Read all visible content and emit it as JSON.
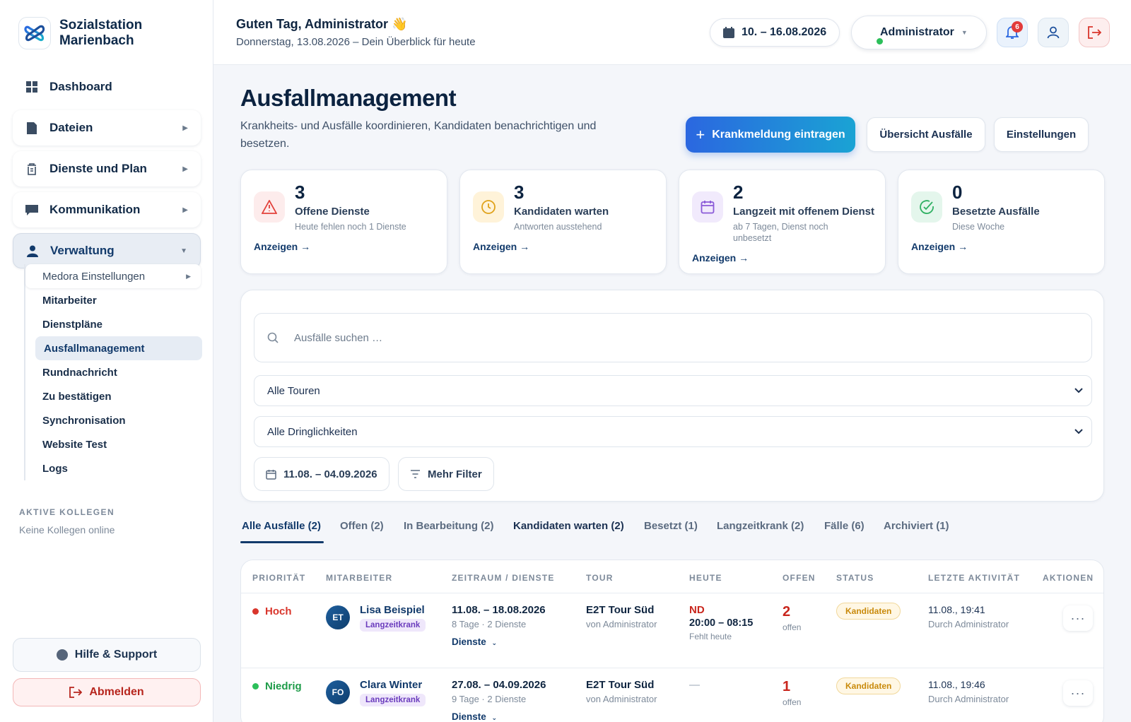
{
  "brand": {
    "name": "Sozialstation Marienbach"
  },
  "nav": {
    "items": [
      {
        "label": "Dashboard"
      },
      {
        "label": "Dateien"
      },
      {
        "label": "Dienste und Plan"
      },
      {
        "label": "Kommunikation"
      },
      {
        "label": "Verwaltung"
      }
    ],
    "sub": [
      {
        "label": "Medora Einstellungen"
      },
      {
        "label": "Mitarbeiter"
      },
      {
        "label": "Dienstpläne"
      },
      {
        "label": "Ausfallmanagement"
      },
      {
        "label": "Rundnachricht"
      },
      {
        "label": "Zu bestätigen"
      },
      {
        "label": "Synchronisation"
      },
      {
        "label": "Website Test"
      },
      {
        "label": "Logs"
      }
    ]
  },
  "colleagues": {
    "title": "AKTIVE KOLLEGEN",
    "text": "Keine Kollegen online"
  },
  "footer": {
    "help": "Hilfe & Support",
    "logout": "Abmelden"
  },
  "header": {
    "greeting": "Guten Tag, Administrator",
    "wave": "👋",
    "subtitle": "Donnerstag, 13.08.2026 – Dein Überblick für heute",
    "date_range": "10. – 16.08.2026",
    "user": "Administrator",
    "notifications": "6"
  },
  "page": {
    "title": "Ausfallmanagement",
    "description": "Krankheits- und Ausfälle koordinieren, Kandidaten benachrichtigen und besetzen.",
    "primary": "Krankmeldung eintragen",
    "overview": "Übersicht Ausfälle",
    "settings": "Einstellungen"
  },
  "stats": [
    {
      "value": "3",
      "label": "Offene Dienste",
      "sub": "Heute fehlen noch 1 Dienste",
      "link": "Anzeigen →",
      "color": "#e2403a"
    },
    {
      "value": "3",
      "label": "Kandidaten warten",
      "sub": "Antworten ausstehend",
      "link": "Anzeigen →",
      "color": "#e0a21a"
    },
    {
      "value": "2",
      "label": "Langzeit mit offenem Dienst",
      "sub": "ab 7 Tagen, Dienst noch unbesetzt",
      "link": "Anzeigen →",
      "color": "#8a5ad8"
    },
    {
      "value": "0",
      "label": "Besetzte Ausfälle",
      "sub": "Diese Woche",
      "link": "Anzeigen →",
      "color": "#2fb062"
    }
  ],
  "filters": {
    "search_placeholder": "Ausfälle suchen …",
    "tours": "Alle Touren",
    "urgency": "Alle Dringlichkeiten",
    "date": "11.08. – 04.09.2026",
    "more": "Mehr Filter"
  },
  "tabs": [
    "Alle Ausfälle (2)",
    "Offen (2)",
    "In Bearbeitung (2)",
    "Kandidaten warten (2)",
    "Besetzt (1)",
    "Langzeitkrank (2)",
    "Fälle (6)",
    "Archiviert (1)"
  ],
  "table": {
    "headers": [
      "PRIORITÄT",
      "MITARBEITER",
      "ZEITRAUM / DIENSTE",
      "TOUR",
      "HEUTE",
      "OFFEN",
      "STATUS",
      "LETZTE AKTIVITÄT",
      "AKTIONEN"
    ],
    "rows": [
      {
        "priority": "Hoch",
        "priority_color": "#d9362c",
        "initials": "ET",
        "name": "Lisa Beispiel",
        "tag": "Langzeitkrank",
        "period": "11.08. – 18.08.2026",
        "period_sub": "8 Tage · 2 Dienste",
        "dienste": "Dienste",
        "tour": "E2T Tour Süd",
        "tour_sub": "von Administrator",
        "today_code": "ND",
        "today_time": "20:00 – 08:15",
        "today_sub": "Fehlt heute",
        "open": "2",
        "open_sub": "offen",
        "status": "Kandidaten",
        "last": "11.08., 19:41",
        "last_sub": "Durch Administrator"
      },
      {
        "priority": "Niedrig",
        "priority_color": "#1f9c4a",
        "initials": "FO",
        "name": "Clara Winter",
        "tag": "Langzeitkrank",
        "period": "27.08. – 04.09.2026",
        "period_sub": "9 Tage · 2 Dienste",
        "dienste": "Dienste",
        "tour": "E2T Tour Süd",
        "tour_sub": "von Administrator",
        "today_dash": "—",
        "open": "1",
        "open_sub": "offen",
        "status": "Kandidaten",
        "last": "11.08., 19:46",
        "last_sub": "Durch Administrator"
      }
    ]
  }
}
